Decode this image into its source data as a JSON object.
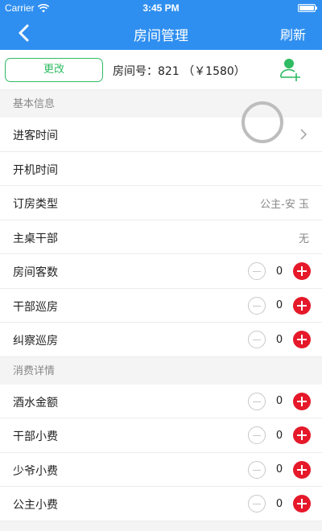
{
  "status_bar": {
    "carrier": "Carrier",
    "time": "3:45 PM",
    "icons": [
      "wifi-icon",
      "battery-icon"
    ]
  },
  "nav": {
    "back_icon": "chevron-left-icon",
    "title": "房间管理",
    "refresh_label": "刷新"
  },
  "toolbar": {
    "change_label": "更改",
    "room_info": "房间号：821 （￥1580）",
    "add_user_icon": "add-user-icon",
    "accent_green": "#2fbb63"
  },
  "basic": {
    "header": "基本信息",
    "checkin_time": {
      "label": "进客时间"
    },
    "open_time": {
      "label": "开机时间"
    },
    "booking_type": {
      "label": "订房类型",
      "value": "公主-安 玉"
    },
    "main_table": {
      "label": "主桌干部",
      "value": "无"
    },
    "guest_count": {
      "label": "房间客数",
      "value": "0"
    },
    "cadre_patrol": {
      "label": "干部巡房",
      "value": "0"
    },
    "inspect_patrol": {
      "label": "纠察巡房",
      "value": "0"
    }
  },
  "consumption": {
    "header": "消费详情",
    "drinks_amount": {
      "label": "酒水金额",
      "value": "0"
    },
    "cadre_tip": {
      "label": "干部小费",
      "value": "0"
    },
    "young_master_tip": {
      "label": "少爷小费",
      "value": "0"
    },
    "princess_tip": {
      "label": "公主小费",
      "value": "0"
    }
  },
  "colors": {
    "primary_blue": "#2f8ff0",
    "plus_red": "#e5192a",
    "minus_gray": "#c8c8c8"
  }
}
